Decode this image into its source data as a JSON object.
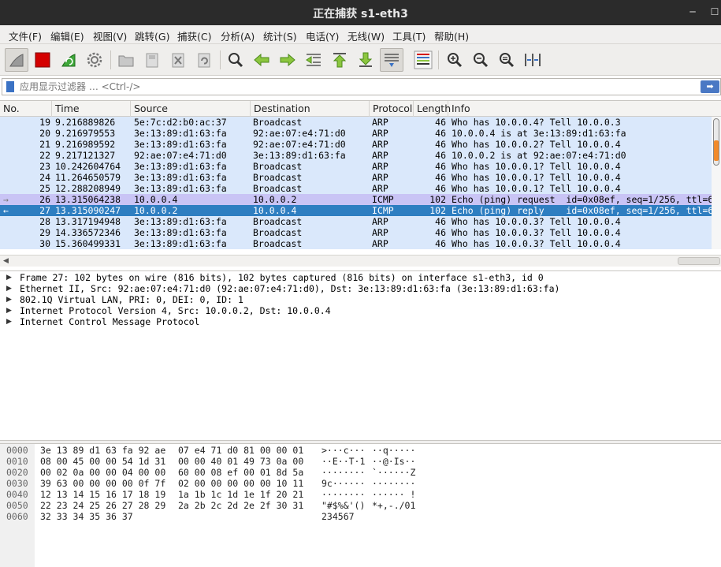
{
  "window": {
    "title": "正在捕获 s1-eth3",
    "minimize_glyph": "─",
    "maximize_glyph": "☐"
  },
  "menu": [
    "文件(F)",
    "编辑(E)",
    "视图(V)",
    "跳转(G)",
    "捕获(C)",
    "分析(A)",
    "统计(S)",
    "电话(Y)",
    "无线(W)",
    "工具(T)",
    "帮助(H)"
  ],
  "toolbar": {
    "icons": [
      "shark-fin-start-icon",
      "stop-capture-icon",
      "restart-capture-icon",
      "capture-options-gear-icon",
      "open-file-icon",
      "save-file-icon",
      "close-file-icon",
      "reload-file-icon",
      "find-packet-icon",
      "go-back-arrow-icon",
      "go-forward-arrow-icon",
      "go-to-packet-icon",
      "go-first-packet-icon",
      "go-last-packet-icon",
      "autoscroll-icon",
      "colorize-icon",
      "zoom-in-icon",
      "zoom-out-icon",
      "zoom-normal-icon",
      "resize-columns-icon"
    ],
    "accent_stop": "#d40000",
    "accent_green": "#3fa83a"
  },
  "filter": {
    "placeholder": "应用显示过滤器 … <Ctrl-/>",
    "value": "",
    "apply_glyph": "➡"
  },
  "packet_list": {
    "columns": [
      "No.",
      "Time",
      "Source",
      "Destination",
      "Protocol",
      "Length",
      "Info"
    ],
    "rows": [
      {
        "no": "19",
        "time": "9.216889826",
        "src": "5e:7c:d2:b0:ac:37",
        "dst": "Broadcast",
        "proto": "ARP",
        "len": "46",
        "info": "Who has 10.0.0.4? Tell 10.0.0.3",
        "color": "#dae8fb",
        "fg": "#000000",
        "marker": ""
      },
      {
        "no": "20",
        "time": "9.216979553",
        "src": "3e:13:89:d1:63:fa",
        "dst": "92:ae:07:e4:71:d0",
        "proto": "ARP",
        "len": "46",
        "info": "10.0.0.4 is at 3e:13:89:d1:63:fa",
        "color": "#dae8fb",
        "fg": "#000000",
        "marker": ""
      },
      {
        "no": "21",
        "time": "9.216989592",
        "src": "3e:13:89:d1:63:fa",
        "dst": "92:ae:07:e4:71:d0",
        "proto": "ARP",
        "len": "46",
        "info": "Who has 10.0.0.2? Tell 10.0.0.4",
        "color": "#dae8fb",
        "fg": "#000000",
        "marker": ""
      },
      {
        "no": "22",
        "time": "9.217121327",
        "src": "92:ae:07:e4:71:d0",
        "dst": "3e:13:89:d1:63:fa",
        "proto": "ARP",
        "len": "46",
        "info": "10.0.0.2 is at 92:ae:07:e4:71:d0",
        "color": "#dae8fb",
        "fg": "#000000",
        "marker": ""
      },
      {
        "no": "23",
        "time": "10.242604764",
        "src": "3e:13:89:d1:63:fa",
        "dst": "Broadcast",
        "proto": "ARP",
        "len": "46",
        "info": "Who has 10.0.0.1? Tell 10.0.0.4",
        "color": "#dae8fb",
        "fg": "#000000",
        "marker": ""
      },
      {
        "no": "24",
        "time": "11.264650579",
        "src": "3e:13:89:d1:63:fa",
        "dst": "Broadcast",
        "proto": "ARP",
        "len": "46",
        "info": "Who has 10.0.0.1? Tell 10.0.0.4",
        "color": "#dae8fb",
        "fg": "#000000",
        "marker": ""
      },
      {
        "no": "25",
        "time": "12.288208949",
        "src": "3e:13:89:d1:63:fa",
        "dst": "Broadcast",
        "proto": "ARP",
        "len": "46",
        "info": "Who has 10.0.0.1? Tell 10.0.0.4",
        "color": "#dae8fb",
        "fg": "#000000",
        "marker": ""
      },
      {
        "no": "26",
        "time": "13.315064238",
        "src": "10.0.0.4",
        "dst": "10.0.0.2",
        "proto": "ICMP",
        "len": "102",
        "info": "Echo (ping) request  id=0x08ef, seq=1/256, ttl=64",
        "color": "#c9c4f5",
        "fg": "#000000",
        "marker": "→"
      },
      {
        "no": "27",
        "time": "13.315090247",
        "src": "10.0.0.2",
        "dst": "10.0.0.4",
        "proto": "ICMP",
        "len": "102",
        "info": "Echo (ping) reply    id=0x08ef, seq=1/256, ttl=64",
        "color": "#2e7ec1",
        "fg": "#ffffff",
        "marker": "←"
      },
      {
        "no": "28",
        "time": "13.317194948",
        "src": "3e:13:89:d1:63:fa",
        "dst": "Broadcast",
        "proto": "ARP",
        "len": "46",
        "info": "Who has 10.0.0.3? Tell 10.0.0.4",
        "color": "#dae8fb",
        "fg": "#000000",
        "marker": ""
      },
      {
        "no": "29",
        "time": "14.336572346",
        "src": "3e:13:89:d1:63:fa",
        "dst": "Broadcast",
        "proto": "ARP",
        "len": "46",
        "info": "Who has 10.0.0.3? Tell 10.0.0.4",
        "color": "#dae8fb",
        "fg": "#000000",
        "marker": ""
      },
      {
        "no": "30",
        "time": "15.360499331",
        "src": "3e:13:89:d1:63:fa",
        "dst": "Broadcast",
        "proto": "ARP",
        "len": "46",
        "info": "Who has 10.0.0.3? Tell 10.0.0.4",
        "color": "#dae8fb",
        "fg": "#000000",
        "marker": ""
      }
    ]
  },
  "details": [
    "Frame 27: 102 bytes on wire (816 bits), 102 bytes captured (816 bits) on interface s1-eth3, id 0",
    "Ethernet II, Src: 92:ae:07:e4:71:d0 (92:ae:07:e4:71:d0), Dst: 3e:13:89:d1:63:fa (3e:13:89:d1:63:fa)",
    "802.1Q Virtual LAN, PRI: 0, DEI: 0, ID: 1",
    "Internet Protocol Version 4, Src: 10.0.0.2, Dst: 10.0.0.4",
    "Internet Control Message Protocol"
  ],
  "hex": [
    {
      "off": "0000",
      "b1": "3e 13 89 d1 63 fa 92 ae",
      "b2": "07 e4 71 d0 81 00 00 01",
      "a1": ">···c···",
      "a2": "··q·····"
    },
    {
      "off": "0010",
      "b1": "08 00 45 00 00 54 1d 31",
      "b2": "00 00 40 01 49 73 0a 00",
      "a1": "··E··T·1",
      "a2": "··@·Is··"
    },
    {
      "off": "0020",
      "b1": "00 02 0a 00 00 04 00 00",
      "b2": "60 00 08 ef 00 01 8d 5a",
      "a1": "········",
      "a2": "`······Z"
    },
    {
      "off": "0030",
      "b1": "39 63 00 00 00 00 0f 7f",
      "b2": "02 00 00 00 00 00 10 11",
      "a1": "9c······",
      "a2": "········"
    },
    {
      "off": "0040",
      "b1": "12 13 14 15 16 17 18 19",
      "b2": "1a 1b 1c 1d 1e 1f 20 21",
      "a1": "········",
      "a2": "······ !"
    },
    {
      "off": "0050",
      "b1": "22 23 24 25 26 27 28 29",
      "b2": "2a 2b 2c 2d 2e 2f 30 31",
      "a1": "\"#$%&'()",
      "a2": "*+,-./01"
    },
    {
      "off": "0060",
      "b1": "32 33 34 35 36 37",
      "b2": "",
      "a1": "234567",
      "a2": ""
    }
  ]
}
